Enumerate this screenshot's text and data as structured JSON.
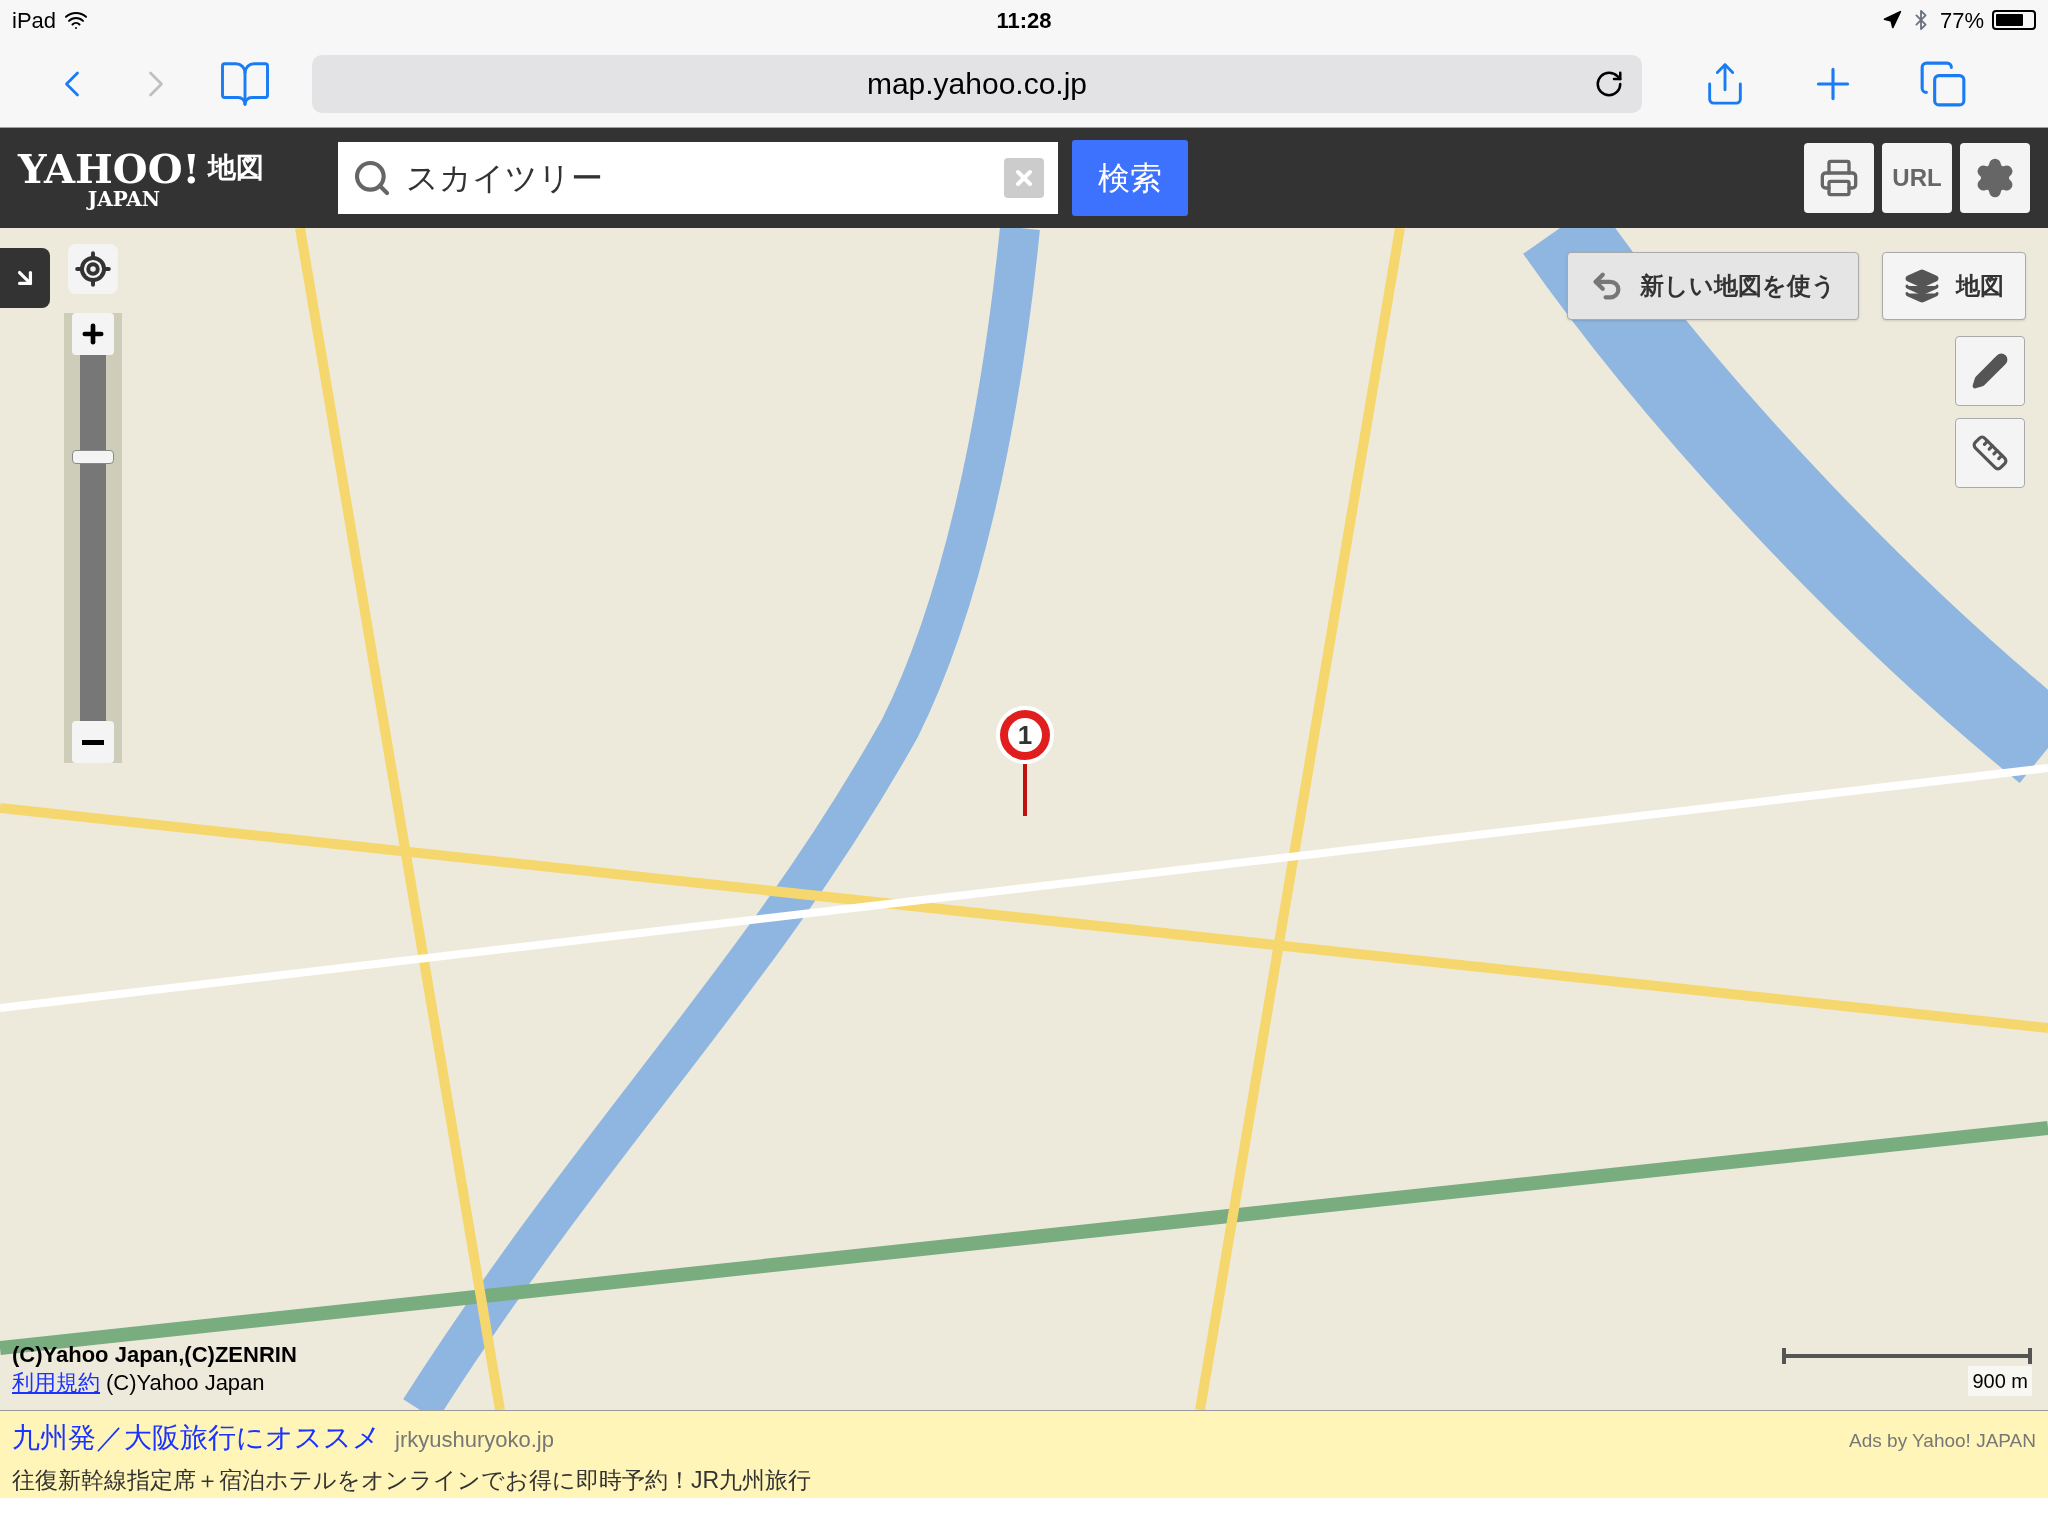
{
  "status_bar": {
    "device": "iPad",
    "time": "11:28",
    "battery": "77%"
  },
  "browser": {
    "url": "map.yahoo.co.jp"
  },
  "header": {
    "logo": "YAHOO!",
    "logo_sub": "JAPAN",
    "service": "地図",
    "search": {
      "value": "スカイツリー"
    },
    "search_button": "検索",
    "tools": [
      "URL"
    ]
  },
  "map": {
    "new_map_button": "新しい地図を使う",
    "layer_button": "地図",
    "zoom": {
      "level": 0.72
    },
    "pin_label": "1",
    "copyright": "(C)Yahoo Japan,(C)ZENRIN",
    "terms_link": "利用規約",
    "copyright2": "(C)Yahoo Japan",
    "scale": "900 m"
  },
  "ad": {
    "title": "九州発／大阪旅行にオススメ",
    "domain": "jrkyushuryoko.jp",
    "credit": "Ads by Yahoo! JAPAN",
    "description": "往復新幹線指定席＋宿泊ホテルをオンラインでお得に即時予約！JR九州旅行"
  }
}
